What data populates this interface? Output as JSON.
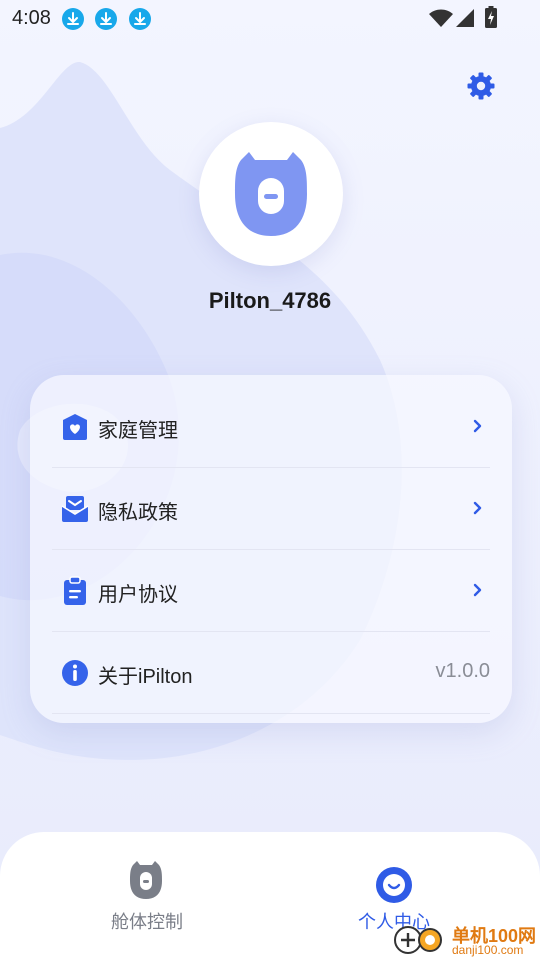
{
  "status_bar": {
    "time": "4:08",
    "download_icons": [
      "download-icon",
      "download-icon",
      "download-icon"
    ]
  },
  "profile": {
    "username": "Pilton_4786"
  },
  "menu": {
    "items": [
      {
        "label": "家庭管理",
        "icon": "home-heart-icon",
        "action": "chevron-right-icon"
      },
      {
        "label": "隐私政策",
        "icon": "privacy-mail-icon",
        "action": "chevron-right-icon"
      },
      {
        "label": "用户协议",
        "icon": "clipboard-icon",
        "action": "chevron-right-icon"
      },
      {
        "label": "关于iPilton",
        "icon": "info-icon",
        "version": "v1.0.0"
      }
    ]
  },
  "tab_bar": {
    "tabs": [
      {
        "label": "舱体控制",
        "icon": "robot-head-icon",
        "active": false
      },
      {
        "label": "个人中心",
        "icon": "user-smile-icon",
        "active": true
      }
    ]
  },
  "watermark": {
    "brand": "单机100网",
    "url": "danji100.com"
  },
  "colors": {
    "accent": "#2f5be6",
    "icon_blue": "#3563ea",
    "mascot": "#7f96f2",
    "inactive_tab": "#7a7e88",
    "background": "#eceffd"
  }
}
